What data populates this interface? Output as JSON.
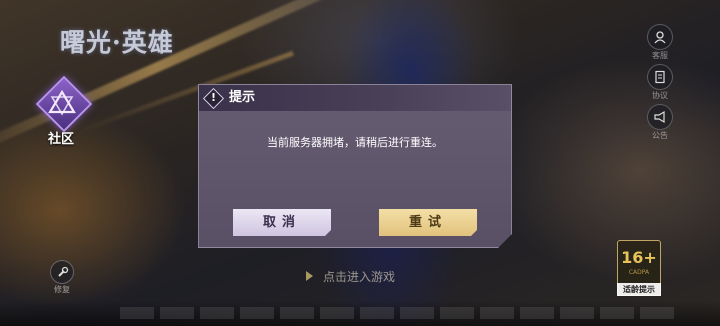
{
  "logo": {
    "title": "曙光·英雄",
    "subtitle": ""
  },
  "community": {
    "label": "社区",
    "icon": "community-triangle-icon"
  },
  "side_menu": [
    {
      "label": "客服",
      "icon": "customer-service-icon"
    },
    {
      "label": "协议",
      "icon": "agreement-icon"
    },
    {
      "label": "公告",
      "icon": "announcement-icon"
    }
  ],
  "repair": {
    "label": "修复",
    "icon": "wrench-icon"
  },
  "enter_game": {
    "label": "点击进入游戏"
  },
  "age_rating": {
    "number": "16+",
    "sub": "CADPA",
    "tip": "适龄提示"
  },
  "dialog": {
    "title": "提示",
    "message": "当前服务器拥堵，请稍后进行重连。",
    "cancel_label": "取消",
    "retry_label": "重试",
    "icon": "warning-icon"
  },
  "colors": {
    "dialog_bg": "#5f5670",
    "retry_bg": "#ead08f",
    "cancel_bg": "#ddd5ea",
    "accent_purple": "#8b63c9"
  }
}
